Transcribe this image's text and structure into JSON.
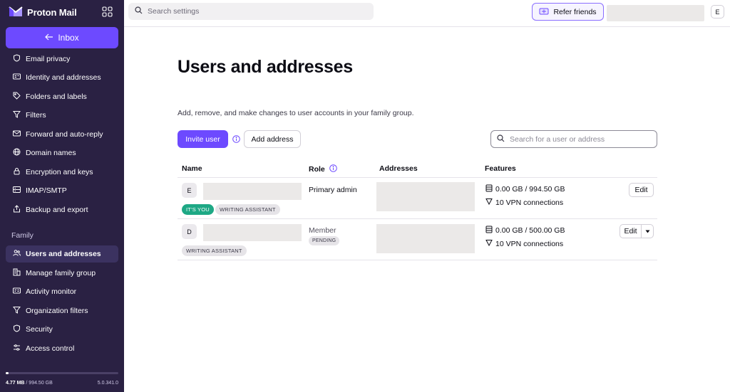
{
  "app": {
    "brand": "Proton Mail",
    "accent": "#6d4aff",
    "sidebar_bg": "#2a2143"
  },
  "sidebar": {
    "inbox_label": "Inbox",
    "items": [
      {
        "label": "Email privacy",
        "icon": "shield-icon"
      },
      {
        "label": "Identity and addresses",
        "icon": "id-card-icon"
      },
      {
        "label": "Folders and labels",
        "icon": "tag-icon"
      },
      {
        "label": "Filters",
        "icon": "filter-icon"
      },
      {
        "label": "Forward and auto-reply",
        "icon": "envelope-forward-icon"
      },
      {
        "label": "Domain names",
        "icon": "globe-icon"
      },
      {
        "label": "Encryption and keys",
        "icon": "lock-icon"
      },
      {
        "label": "IMAP/SMTP",
        "icon": "server-icon"
      },
      {
        "label": "Backup and export",
        "icon": "export-icon"
      }
    ],
    "section_family": "Family",
    "family_items": [
      {
        "label": "Users and addresses",
        "icon": "users-icon",
        "active": true
      },
      {
        "label": "Manage family group",
        "icon": "buildings-icon"
      },
      {
        "label": "Activity monitor",
        "icon": "monitor-icon"
      },
      {
        "label": "Organization filters",
        "icon": "filter-icon"
      },
      {
        "label": "Security",
        "icon": "shield-icon"
      },
      {
        "label": "Access control",
        "icon": "sliders-icon"
      }
    ],
    "storage_used": "4.77 MB",
    "storage_total": "/ 994.50 GB",
    "storage_fraction": 0.005,
    "version": "5.0.341.0"
  },
  "topbar": {
    "search_placeholder": "Search settings",
    "refer_label": "Refer friends",
    "avatar_initial": "E"
  },
  "main": {
    "title": "Users and addresses",
    "description": "Add, remove, and make changes to user accounts in your family group.",
    "invite_label": "Invite user",
    "add_address_label": "Add address",
    "user_search_placeholder": "Search for a user or address",
    "columns": {
      "name": "Name",
      "role": "Role",
      "addresses": "Addresses",
      "features": "Features"
    },
    "rows": [
      {
        "initial": "E",
        "badges": [
          "IT'S YOU",
          "WRITING ASSISTANT"
        ],
        "role": "Primary admin",
        "storage": "0.00 GB / 994.50 GB",
        "vpn": "10 VPN connections",
        "edit": "Edit"
      },
      {
        "initial": "D",
        "badges": [
          "WRITING ASSISTANT"
        ],
        "role": "Member",
        "role_badge": "PENDING",
        "storage": "0.00 GB / 500.00 GB",
        "vpn": "10 VPN connections",
        "edit": "Edit"
      }
    ]
  }
}
